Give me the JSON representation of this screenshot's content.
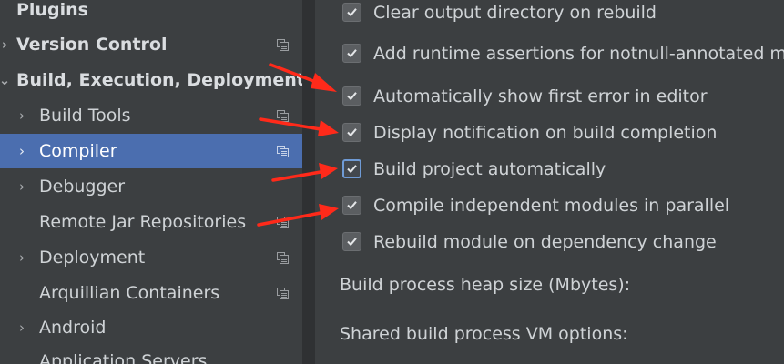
{
  "sidebar": {
    "items": [
      {
        "label": "Plugins",
        "expand": ""
      },
      {
        "label": "Version Control",
        "expand": "›"
      },
      {
        "label": "Build, Execution, Deployment",
        "expand": "⌄"
      },
      {
        "label": "Build Tools",
        "expand": "›"
      },
      {
        "label": "Compiler",
        "expand": "›"
      },
      {
        "label": "Debugger",
        "expand": "›"
      },
      {
        "label": "Remote Jar Repositories",
        "expand": ""
      },
      {
        "label": "Deployment",
        "expand": "›"
      },
      {
        "label": "Arquillian Containers",
        "expand": ""
      },
      {
        "label": "Android",
        "expand": "›"
      },
      {
        "label": "Application Servers",
        "expand": ""
      }
    ],
    "selected": "Compiler"
  },
  "compiler": {
    "options": [
      {
        "label": "Clear output directory on rebuild",
        "checked": true
      },
      {
        "label": "Add runtime assertions for notnull-annotated m",
        "checked": true
      },
      {
        "label": "Automatically show first error in editor",
        "checked": true
      },
      {
        "label": "Display notification on build completion",
        "checked": true
      },
      {
        "label": "Build project automatically",
        "checked": true
      },
      {
        "label": "Compile independent modules in parallel",
        "checked": true
      },
      {
        "label": "Rebuild module on dependency change",
        "checked": true
      }
    ],
    "heap_label": "Build process heap size (Mbytes):",
    "vm_label": "Shared build process VM options:"
  },
  "colors": {
    "selection": "#4b6eaf",
    "background": "#3c3f41",
    "annotation_arrow": "#ff2a1a"
  }
}
